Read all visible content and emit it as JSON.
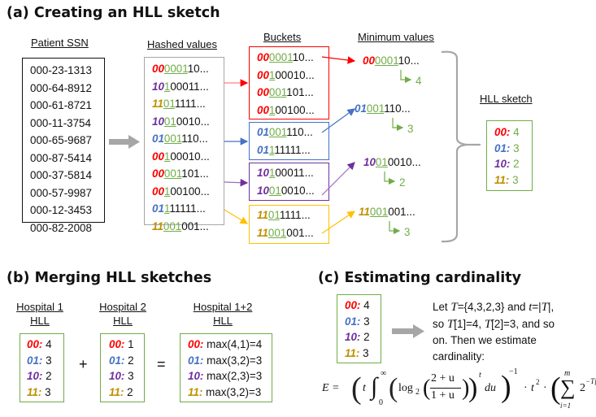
{
  "colors": {
    "p00": "#ff0000",
    "p01": "#4472c4",
    "p10": "#7030a0",
    "p11": "#bf9000",
    "leading_zeros": "#70ad47",
    "arrow_gray": "#a6a6a6"
  },
  "panel_a": {
    "title": "(a) Creating an HLL sketch",
    "headers": {
      "ssn": "Patient SSN",
      "hashed": "Hashed values",
      "buckets": "Buckets",
      "minimum": "Minimum values",
      "sketch": "HLL sketch"
    },
    "ssns": [
      "000-23-1313",
      "000-64-8912",
      "000-61-8721",
      "000-11-3754",
      "000-65-9687",
      "000-87-5414",
      "000-37-5814",
      "000-57-9987",
      "000-12-3453",
      "000-82-2008"
    ],
    "hashed_values": [
      {
        "prefix": "00",
        "zeros": "0001",
        "rest": "10...",
        "bucket": "p00"
      },
      {
        "prefix": "10",
        "zeros": "1",
        "rest": "00011...",
        "bucket": "p10"
      },
      {
        "prefix": "11",
        "zeros": "01",
        "rest": "1111...",
        "bucket": "p11"
      },
      {
        "prefix": "10",
        "zeros": "01",
        "rest": "0010...",
        "bucket": "p10"
      },
      {
        "prefix": "01",
        "zeros": "001",
        "rest": "110...",
        "bucket": "p01"
      },
      {
        "prefix": "00",
        "zeros": "1",
        "rest": "00010...",
        "bucket": "p00"
      },
      {
        "prefix": "00",
        "zeros": "001",
        "rest": "101...",
        "bucket": "p00"
      },
      {
        "prefix": "00",
        "zeros": "1",
        "rest": "00100...",
        "bucket": "p00"
      },
      {
        "prefix": "01",
        "zeros": "1",
        "rest": "11111...",
        "bucket": "p01"
      },
      {
        "prefix": "11",
        "zeros": "001",
        "rest": "001...",
        "bucket": "p11"
      }
    ],
    "buckets": [
      {
        "key": "p00",
        "items": [
          {
            "prefix": "00",
            "zeros": "0001",
            "rest": "10..."
          },
          {
            "prefix": "00",
            "zeros": "1",
            "rest": "00010..."
          },
          {
            "prefix": "00",
            "zeros": "001",
            "rest": "101..."
          },
          {
            "prefix": "00",
            "zeros": "1",
            "rest": "00100..."
          }
        ]
      },
      {
        "key": "p01",
        "items": [
          {
            "prefix": "01",
            "zeros": "001",
            "rest": "110..."
          },
          {
            "prefix": "01",
            "zeros": "1",
            "rest": "11111..."
          }
        ]
      },
      {
        "key": "p10",
        "items": [
          {
            "prefix": "10",
            "zeros": "1",
            "rest": "00011..."
          },
          {
            "prefix": "10",
            "zeros": "01",
            "rest": "0010..."
          }
        ]
      },
      {
        "key": "p11",
        "items": [
          {
            "prefix": "11",
            "zeros": "01",
            "rest": "1111..."
          },
          {
            "prefix": "11",
            "zeros": "001",
            "rest": "001..."
          }
        ]
      }
    ],
    "minimum_values": [
      {
        "key": "p00",
        "prefix": "00",
        "zeros": "0001",
        "rest": "10...",
        "rank": "4"
      },
      {
        "key": "p01",
        "prefix": "01",
        "zeros": "001",
        "rest": "110...",
        "rank": "3"
      },
      {
        "key": "p10",
        "prefix": "10",
        "zeros": "01",
        "rest": "0010...",
        "rank": "2"
      },
      {
        "key": "p11",
        "prefix": "11",
        "zeros": "001",
        "rest": "001...",
        "rank": "3"
      }
    ],
    "sketch": [
      {
        "key": "p00",
        "label": "00:",
        "value": "4"
      },
      {
        "key": "p01",
        "label": "01:",
        "value": "3"
      },
      {
        "key": "p10",
        "label": "10:",
        "value": "2"
      },
      {
        "key": "p11",
        "label": "11:",
        "value": "3"
      }
    ]
  },
  "panel_b": {
    "title": "(b) Merging HLL sketches",
    "h1": {
      "line1": "Hospital 1",
      "line2": "HLL",
      "rows": [
        {
          "key": "p00",
          "label": "00:",
          "value": "4"
        },
        {
          "key": "p01",
          "label": "01:",
          "value": "3"
        },
        {
          "key": "p10",
          "label": "10:",
          "value": "2"
        },
        {
          "key": "p11",
          "label": "11:",
          "value": "3"
        }
      ]
    },
    "h2": {
      "line1": "Hospital 2",
      "line2": "HLL",
      "rows": [
        {
          "key": "p00",
          "label": "00:",
          "value": "1"
        },
        {
          "key": "p01",
          "label": "01:",
          "value": "2"
        },
        {
          "key": "p10",
          "label": "10:",
          "value": "3"
        },
        {
          "key": "p11",
          "label": "11:",
          "value": "2"
        }
      ]
    },
    "h12": {
      "line1": "Hospital 1+2",
      "line2": "HLL",
      "rows": [
        {
          "key": "p00",
          "label": "00:",
          "value": "max(4,1)=4"
        },
        {
          "key": "p01",
          "label": "01:",
          "value": "max(3,2)=3"
        },
        {
          "key": "p10",
          "label": "10:",
          "value": "max(2,3)=3"
        },
        {
          "key": "p11",
          "label": "11:",
          "value": "max(3,2)=3"
        }
      ]
    },
    "plus": "+",
    "equals": "="
  },
  "panel_c": {
    "title": "(c) Estimating cardinality",
    "sketch": [
      {
        "key": "p00",
        "label": "00:",
        "value": "4"
      },
      {
        "key": "p01",
        "label": "01:",
        "value": "3"
      },
      {
        "key": "p10",
        "label": "10:",
        "value": "2"
      },
      {
        "key": "p11",
        "label": "11:",
        "value": "3"
      }
    ],
    "text": {
      "l1a": "Let ",
      "T1": "T",
      "l1b": "={4,3,2,3} and ",
      "t1": "t",
      "l1c": "=|",
      "T2": "T",
      "l1d": "|,",
      "l2a": "so ",
      "T3": "T",
      "l2b": "[1]=4, ",
      "T4": "T",
      "l2c": "[2]=3, and so",
      "l3": "on. Then we estimate",
      "l4": "cardinality:"
    },
    "formula": {
      "lhs": "E =",
      "t": "t",
      "int_upper": "∞",
      "int_lower": "0",
      "log": "log",
      "log_base": "2",
      "num": "2 + u",
      "den": "1 + u",
      "power_t": "t",
      "du": "du",
      "neg1": "−1",
      "dot": "·",
      "t2": "t",
      "sq": "2",
      "sum_upper": "m",
      "sum_lower": "i=1",
      "two": "2",
      "exp": "−T[i]"
    }
  }
}
